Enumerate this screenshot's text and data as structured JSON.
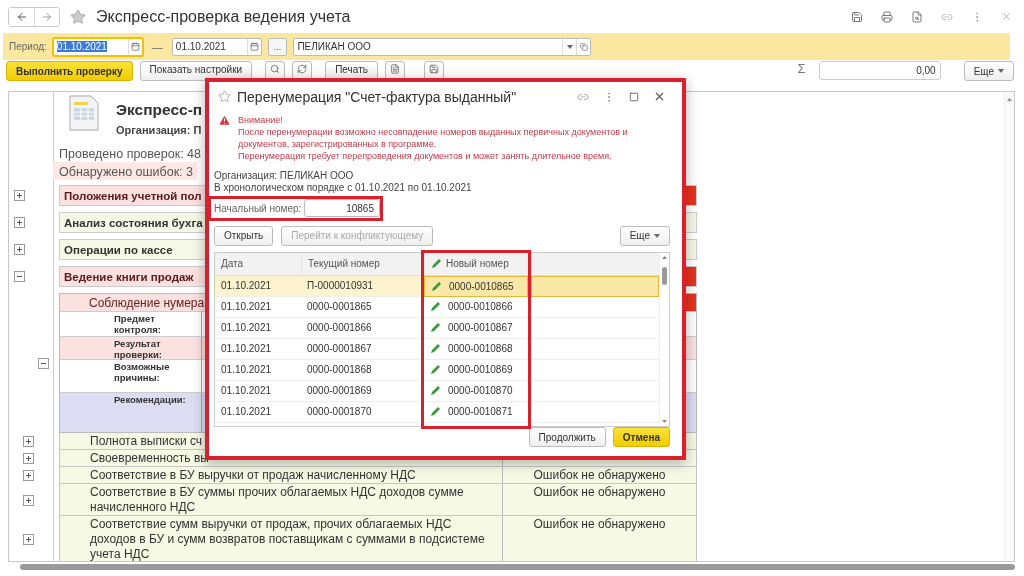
{
  "window": {
    "title": "Экспресс-проверка ведения учета"
  },
  "filter": {
    "label": "Период:",
    "date_from": "01.10.2021",
    "date_from_focused": true,
    "dash": "—",
    "date_to": "01.10.2021",
    "choose_button": "...",
    "organization": "ПЕЛИКАН ООО"
  },
  "toolbar": {
    "run_button": "Выполнить проверку",
    "settings_button": "Показать настройки",
    "print_button": "Печать",
    "sum_sign": "Σ",
    "sum_value": "0,00",
    "more_button": "Еще"
  },
  "report": {
    "title": "Экспресс-п",
    "organization": "Организация: П",
    "checks_done": "Проведено проверок: 48",
    "errors_found": "Обнаружено ошибок: 3",
    "sections": [
      {
        "title": "Положения учетной пол",
        "has_errors": true,
        "expanded": false
      },
      {
        "title": "Анализ состояния бухга",
        "has_errors": false,
        "expanded": false
      },
      {
        "title": "Операции по кассе",
        "has_errors": false,
        "expanded": false
      },
      {
        "title": "Ведение книги продаж",
        "has_errors": true,
        "expanded": true,
        "children": [
          {
            "kind": "group",
            "title": "Соблюдение нумера",
            "has_errors": true,
            "expanded": true,
            "details": [
              {
                "label": "Предмет контроля:",
                "kind": "plain"
              },
              {
                "label": "Результат проверки:",
                "kind": "error"
              },
              {
                "label": "Возможные причины:",
                "kind": "plain"
              },
              {
                "label": "Рекомендации:",
                "kind": "advice"
              }
            ]
          },
          {
            "kind": "line",
            "title": "Полнота выписки сч",
            "expanded": false
          },
          {
            "kind": "line",
            "title": "Своевременность вы",
            "expanded": false
          },
          {
            "kind": "line",
            "title": "Соответствие в БУ выручки от продаж начисленному НДС",
            "result": "Ошибок не обнаружено",
            "expanded": false
          },
          {
            "kind": "line",
            "title": "Соответствие в БУ суммы прочих облагаемых НДС доходов сумме начисленного НДС",
            "result": "Ошибок не обнаружено",
            "expanded": false
          },
          {
            "kind": "line",
            "title": "Соответствие сумм выручки от продаж, прочих облагаемых НДС доходов в БУ и сумм возвратов поставщикам с суммами в подсистеме учета НДС",
            "result": "Ошибок не обнаружено",
            "expanded": false
          }
        ]
      }
    ]
  },
  "dialog": {
    "title": "Перенумерация \"Счет-фактура выданный\"",
    "warning_title": "Внимание!",
    "warning_text": "После перенумерации возможно несовпадение номеров выданных первичных документов и\nдокументов, зарегистрированных в программе.\nПеренумерация требует перепроведения документов и может занять длительное время.",
    "organization": "Организация: ПЕЛИКАН ООО",
    "period": "В хронологическом порядке с 01.10.2021 по 01.10.2021",
    "start_number_label": "Начальный номер:",
    "start_number": "10865",
    "open_button": "Открыть",
    "goto_button": {
      "label": "Перейти к конфликтующему",
      "disabled": true
    },
    "more_button": "Еще",
    "columns": [
      "Дата",
      "Текущий номер",
      "Новый номер"
    ],
    "rows": [
      {
        "date": "01.10.2021",
        "current": "П-0000010931",
        "new": "0000-0010865",
        "selected": true
      },
      {
        "date": "01.10.2021",
        "current": "0000-0001865",
        "new": "0000-0010866",
        "selected": false
      },
      {
        "date": "01.10.2021",
        "current": "0000-0001866",
        "new": "0000-0010867",
        "selected": false
      },
      {
        "date": "01.10.2021",
        "current": "0000-0001867",
        "new": "0000-0010868",
        "selected": false
      },
      {
        "date": "01.10.2021",
        "current": "0000-0001868",
        "new": "0000-0010869",
        "selected": false
      },
      {
        "date": "01.10.2021",
        "current": "0000-0001869",
        "new": "0000-0010870",
        "selected": false
      },
      {
        "date": "01.10.2021",
        "current": "0000-0001870",
        "new": "0000-0010871",
        "selected": false
      }
    ],
    "continue_button": "Продолжить",
    "cancel_button": "Отмена"
  }
}
